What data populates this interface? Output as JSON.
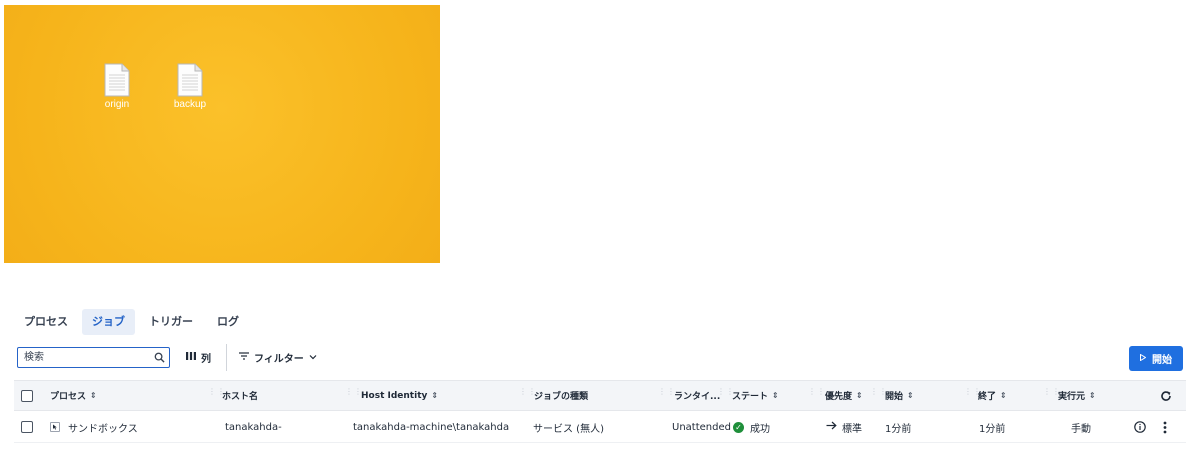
{
  "desktop": {
    "icons": [
      {
        "label": "origin",
        "icon": "text-file-icon"
      },
      {
        "label": "backup",
        "icon": "text-file-icon"
      }
    ],
    "background_color": "#f8bb1e"
  },
  "tabs": [
    {
      "label": "プロセス",
      "active": false
    },
    {
      "label": "ジョブ",
      "active": true
    },
    {
      "label": "トリガー",
      "active": false
    },
    {
      "label": "ログ",
      "active": false
    }
  ],
  "toolbar": {
    "search_placeholder": "検索",
    "columns_label": "列",
    "filter_label": "フィルター",
    "start_label": "開始",
    "accent_color": "#1f6fe0"
  },
  "table": {
    "columns": [
      "プロセス",
      "ホスト名",
      "Host Identity",
      "ジョブの種類",
      "ランタイ...",
      "ステート",
      "優先度",
      "開始",
      "終了",
      "実行元"
    ],
    "rows": [
      {
        "process": "サンドボックス",
        "host": "tanakahda-",
        "identity": "tanakahda-machine\\tanakahda",
        "job_type": "サービス (無人)",
        "runtime": "Unattended",
        "state": "成功",
        "priority": "標準",
        "started": "1分前",
        "ended": "1分前",
        "source": "手動"
      }
    ],
    "status_color": "#1f8f3a"
  }
}
